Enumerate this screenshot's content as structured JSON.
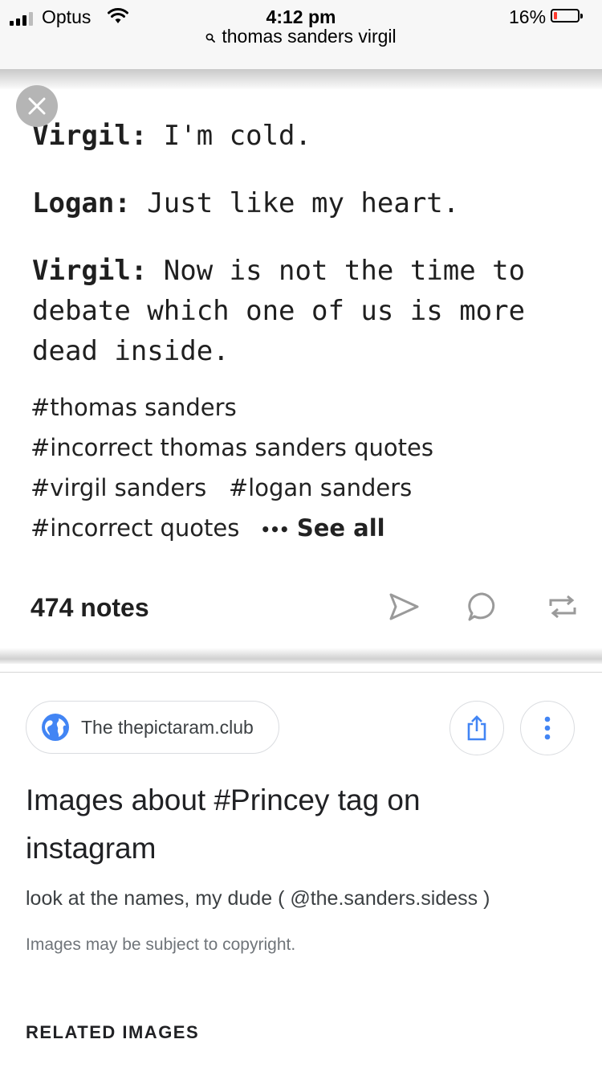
{
  "status_bar": {
    "carrier": "Optus",
    "time": "4:12 pm",
    "battery_percent": "16%",
    "battery_level": 0.16,
    "signal_bars": 3
  },
  "url_bar": {
    "query": "thomas sanders virgil"
  },
  "image": {
    "lines": [
      {
        "speaker": "Virgil:",
        "text": " I'm cold."
      },
      {
        "speaker": "Logan:",
        "text": " Just like my heart."
      },
      {
        "speaker": "Virgil:",
        "text": " Now is not the time to debate which one of us is more dead inside."
      }
    ],
    "tags": {
      "t1": "#thomas sanders",
      "t2": "#incorrect thomas sanders quotes",
      "t3": "#virgil sanders",
      "t4": "#logan sanders",
      "t5": "#incorrect quotes",
      "see_all": "See all",
      "dots": "•••"
    },
    "notes": "474 notes"
  },
  "source": {
    "label": "The thepictaram.club"
  },
  "result": {
    "title": "Images about #Princey tag on instagram",
    "description": "look at the names, my dude ( @the.sanders.sidess )",
    "copyright": "Images may be subject to copyright."
  },
  "related_heading": "RELATED IMAGES",
  "colors": {
    "accent_blue": "#4285f4",
    "battery_low": "#ff3b30",
    "text_primary": "#202124",
    "text_secondary": "#70757a"
  }
}
